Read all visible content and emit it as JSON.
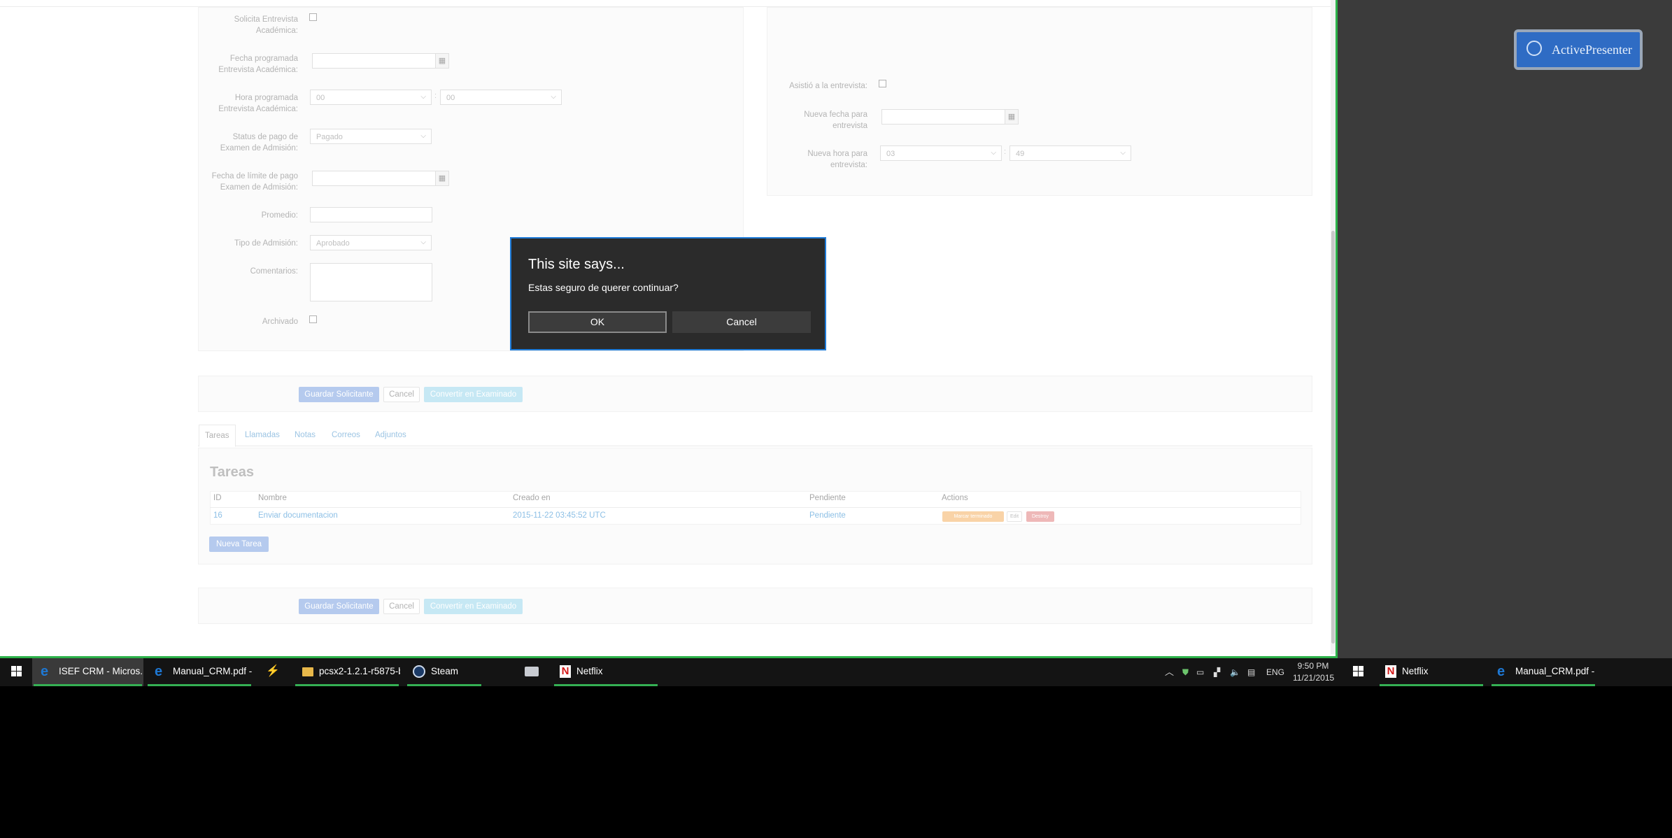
{
  "form": {
    "solicita_entrevista_label": "Solicita Entrevista Académica:",
    "fecha_programada_label": "Fecha programada Entrevista Académica:",
    "hora_programada_label": "Hora programada Entrevista Académica:",
    "hora_programada_h": "00",
    "hora_programada_m": "00",
    "status_pago_label": "Status de pago de Examen de Admisión:",
    "status_pago_value": "Pagado",
    "fecha_limite_label": "Fecha de límite de pago Examen de Admisión:",
    "promedio_label": "Promedio:",
    "tipo_admision_label": "Tipo de Admisión:",
    "tipo_admision_value": "Aprobado",
    "comentarios_label": "Comentarios:",
    "archivado_label": "Archivado"
  },
  "right_form": {
    "asistio_label": "Asistió a la entrevista:",
    "nueva_fecha_label": "Nueva fecha para entrevista",
    "nueva_hora_label": "Nueva hora para entrevista:",
    "nueva_hora_h": "03",
    "nueva_hora_m": "49"
  },
  "actions": {
    "guardar": "Guardar Solicitante",
    "cancel": "Cancel",
    "convertir": "Convertir en Examinado"
  },
  "tabs": [
    "Tareas",
    "Llamadas",
    "Notas",
    "Correos",
    "Adjuntos"
  ],
  "tareas": {
    "title": "Tareas",
    "headers": [
      "ID",
      "Nombre",
      "Creado en",
      "Pendiente",
      "Actions"
    ],
    "rows": [
      {
        "id": "16",
        "nombre": "Enviar documentacion",
        "creado": "2015-11-22 03:45:52 UTC",
        "pendiente": "Pendiente"
      }
    ],
    "row_actions": [
      "Marcar terminado",
      "Edit",
      "Destroy"
    ],
    "nueva_tarea": "Nueva Tarea"
  },
  "dialog": {
    "title": "This site says...",
    "message": "Estas seguro de querer continuar?",
    "ok": "OK",
    "cancel": "Cancel"
  },
  "activepresenter": {
    "label": "ActivePresenter"
  },
  "taskbar": {
    "items": [
      {
        "label": "ISEF CRM - Micros...",
        "icon": "edge-icon"
      },
      {
        "label": "Manual_CRM.pdf - ...",
        "icon": "edge-icon"
      },
      {
        "label": "",
        "icon": "winrar-icon"
      },
      {
        "label": "pcsx2-1.2.1-r5875-b...",
        "icon": "folder-icon"
      },
      {
        "label": "Steam",
        "icon": "steam-icon"
      },
      {
        "label": "",
        "icon": "printer-icon"
      },
      {
        "label": "Netflix",
        "icon": "netflix-icon"
      }
    ],
    "lang": "ENG",
    "time": "9:50 PM",
    "date": "11/21/2015",
    "second_items": [
      {
        "label": "Netflix",
        "icon": "netflix-icon"
      },
      {
        "label": "Manual_CRM.pdf - ...",
        "icon": "edge-icon"
      }
    ]
  }
}
